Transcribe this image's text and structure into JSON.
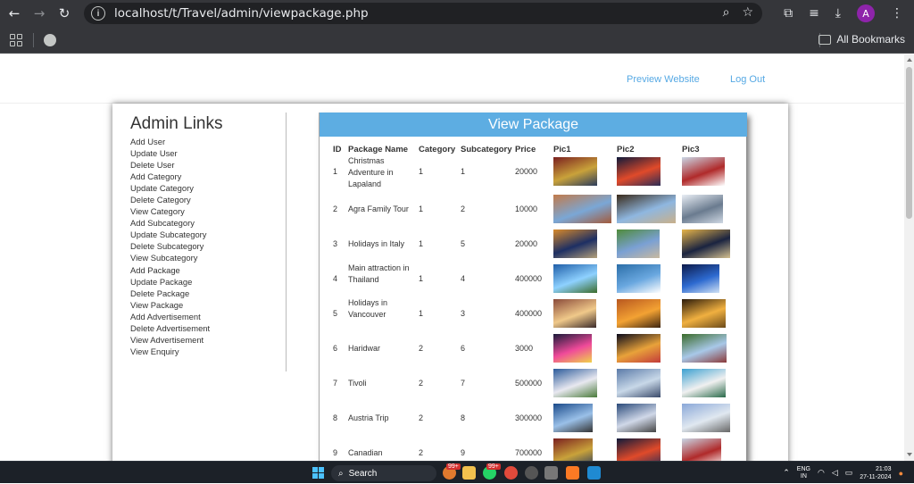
{
  "browser": {
    "url": "localhost/t/Travel/admin/viewpackage.php",
    "bookmarks_label": "All Bookmarks",
    "avatar_letter": "A"
  },
  "site_header": {
    "preview_label": "Preview Website",
    "logout_label": "Log Out",
    "link_color": "#56a9e4"
  },
  "sidebar": {
    "title": "Admin Links",
    "links": [
      "Add User",
      "Update User",
      "Delete User",
      "Add Category",
      "Update Category",
      "Delete Category",
      "View Category",
      "Add Subcategory",
      "Update Subcategory",
      "Delete Subcategory",
      "View Subcategory",
      "Add Package",
      "Update Package",
      "Delete Package",
      "View Package",
      "Add Advertisement",
      "Delete Advertisement",
      "View Advertisement",
      "View Enquiry"
    ]
  },
  "panel": {
    "title": "View Package",
    "header_color": "#5dade2",
    "columns": [
      "ID",
      "Package Name",
      "Category",
      "Subcategory",
      "Price",
      "Pic1",
      "Pic2",
      "Pic3"
    ],
    "rows": [
      {
        "id": "1",
        "name": "Christmas Adventure in Lapaland",
        "category": "1",
        "subcategory": "1",
        "price": "20000"
      },
      {
        "id": "2",
        "name": "Agra Family Tour",
        "category": "1",
        "subcategory": "2",
        "price": "10000"
      },
      {
        "id": "3",
        "name": "Holidays in Italy",
        "category": "1",
        "subcategory": "5",
        "price": "20000"
      },
      {
        "id": "4",
        "name": "Main attraction in Thailand",
        "category": "1",
        "subcategory": "4",
        "price": "400000"
      },
      {
        "id": "5",
        "name": "Holidays in Vancouver",
        "category": "1",
        "subcategory": "3",
        "price": "400000"
      },
      {
        "id": "6",
        "name": "Haridwar",
        "category": "2",
        "subcategory": "6",
        "price": "3000"
      },
      {
        "id": "7",
        "name": "Tivoli",
        "category": "2",
        "subcategory": "7",
        "price": "500000"
      },
      {
        "id": "8",
        "name": "Austria Trip",
        "category": "2",
        "subcategory": "8",
        "price": "300000"
      },
      {
        "id": "9",
        "name": "Canadian",
        "category": "2",
        "subcategory": "9",
        "price": "700000"
      }
    ]
  },
  "taskbar": {
    "search_label": "Search",
    "lang_top": "ENG",
    "lang_bottom": "IN",
    "time": "21:03",
    "date": "27-11-2024",
    "badge_1": "99+",
    "badge_2": "99+"
  }
}
